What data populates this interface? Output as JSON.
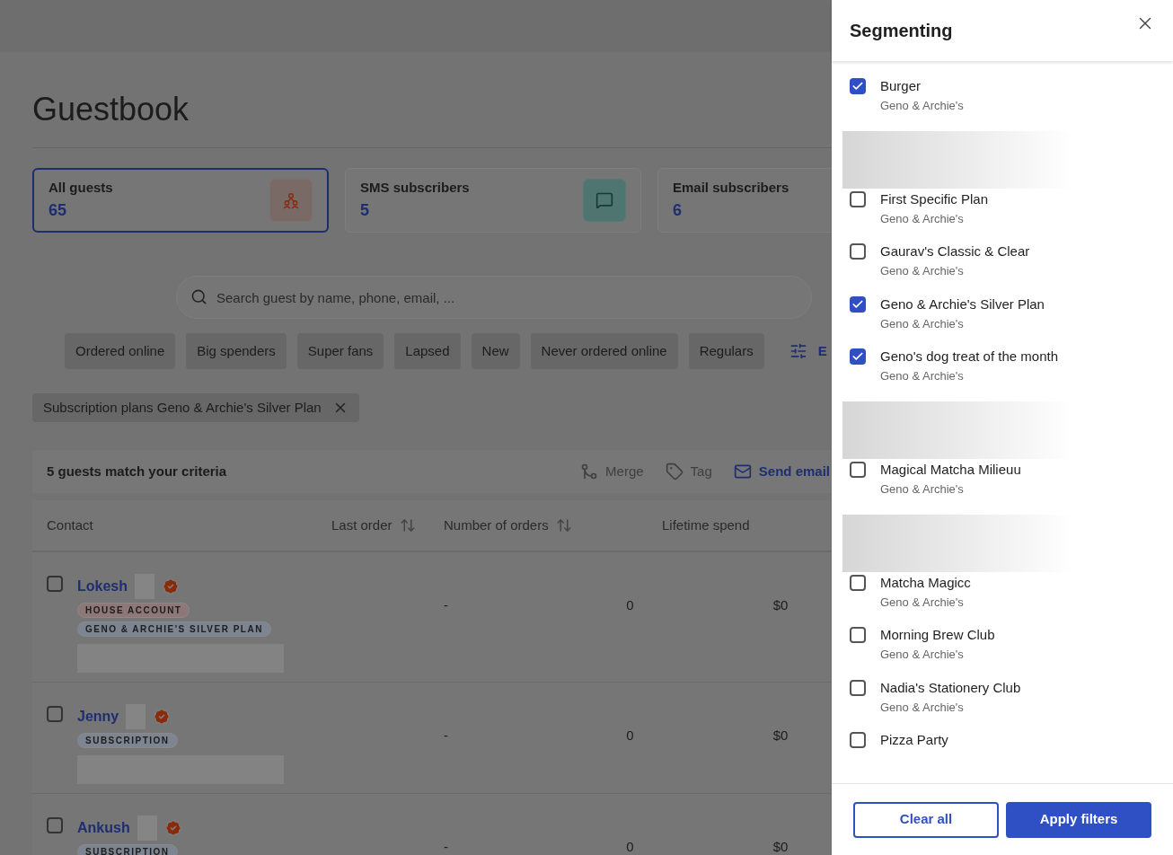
{
  "page": {
    "title": "Guestbook"
  },
  "summary_cards": [
    {
      "label": "All guests",
      "count": "65",
      "selected": true,
      "kind": "people"
    },
    {
      "label": "SMS subscribers",
      "count": "5",
      "selected": false,
      "kind": "chat"
    },
    {
      "label": "Email subscribers",
      "count": "6",
      "selected": false,
      "kind": "plain"
    }
  ],
  "search": {
    "placeholder": "Search guest by name, phone, email, ..."
  },
  "quick_filters": [
    "Ordered online",
    "Big spenders",
    "Super fans",
    "Lapsed",
    "New",
    "Never ordered online",
    "Regulars"
  ],
  "filter_button": {
    "label": "E"
  },
  "active_filters": [
    {
      "label": "Subscription plans Geno & Archie's Silver Plan"
    }
  ],
  "results": {
    "summary": "5 guests match your criteria",
    "actions": [
      {
        "label": "Merge",
        "kind": "merge",
        "disabled": true
      },
      {
        "label": "Tag",
        "kind": "tag",
        "disabled": true
      },
      {
        "label": "Send email",
        "kind": "mail",
        "disabled": false
      }
    ]
  },
  "table": {
    "columns": [
      {
        "label": "Contact",
        "sortable": false
      },
      {
        "label": "Last order",
        "sortable": true
      },
      {
        "label": "Number of orders",
        "sortable": true
      },
      {
        "label": "Lifetime spend",
        "sortable": false
      }
    ],
    "rows": [
      {
        "name": "Lokesh",
        "verified": true,
        "checked": false,
        "tags": [
          {
            "label": "HOUSE ACCOUNT",
            "color": "#8e7777"
          },
          {
            "label": "GENO & ARCHIE'S SILVER PLAN",
            "color": "#7c8591"
          }
        ],
        "last_order": "-",
        "orders": "0",
        "spend": "$0"
      },
      {
        "name": "Jenny",
        "verified": true,
        "checked": false,
        "tags": [
          {
            "label": "SUBSCRIPTION",
            "color": "#7c8591"
          }
        ],
        "last_order": "-",
        "orders": "0",
        "spend": "$0"
      },
      {
        "name": "Ankush",
        "verified": true,
        "checked": false,
        "tags": [
          {
            "label": "SUBSCRIPTION",
            "color": "#7c8591"
          }
        ],
        "last_order": "-",
        "orders": "0",
        "spend": "$0"
      }
    ]
  },
  "panel": {
    "title": "Segmenting",
    "options": [
      {
        "kind": "plan",
        "label": "Burger",
        "sublabel": "Geno & Archie's",
        "checked": true
      },
      {
        "kind": "redacted"
      },
      {
        "kind": "plan",
        "label": "First Specific Plan",
        "sublabel": "Geno & Archie's",
        "checked": false
      },
      {
        "kind": "plan",
        "label": "Gaurav's Classic & Clear",
        "sublabel": "Geno & Archie's",
        "checked": false
      },
      {
        "kind": "plan",
        "label": "Geno & Archie's Silver Plan",
        "sublabel": "Geno & Archie's",
        "checked": true
      },
      {
        "kind": "plan",
        "label": "Geno's dog treat of the month",
        "sublabel": "Geno & Archie's",
        "checked": true
      },
      {
        "kind": "redacted"
      },
      {
        "kind": "plan",
        "label": "Magical Matcha Milieuu",
        "sublabel": "Geno & Archie's",
        "checked": false
      },
      {
        "kind": "redacted"
      },
      {
        "kind": "plan",
        "label": "Matcha Magicc",
        "sublabel": "Geno & Archie's",
        "checked": false
      },
      {
        "kind": "plan",
        "label": "Morning Brew Club",
        "sublabel": "Geno & Archie's",
        "checked": false
      },
      {
        "kind": "plan",
        "label": "Nadia's Stationery Club",
        "sublabel": "Geno & Archie's",
        "checked": false
      },
      {
        "kind": "plan",
        "label": "Pizza Party",
        "checked": false
      }
    ],
    "buttons": [
      {
        "label": "Clear all",
        "kind": "secondary"
      },
      {
        "label": "Apply filters",
        "kind": "primary"
      }
    ]
  }
}
